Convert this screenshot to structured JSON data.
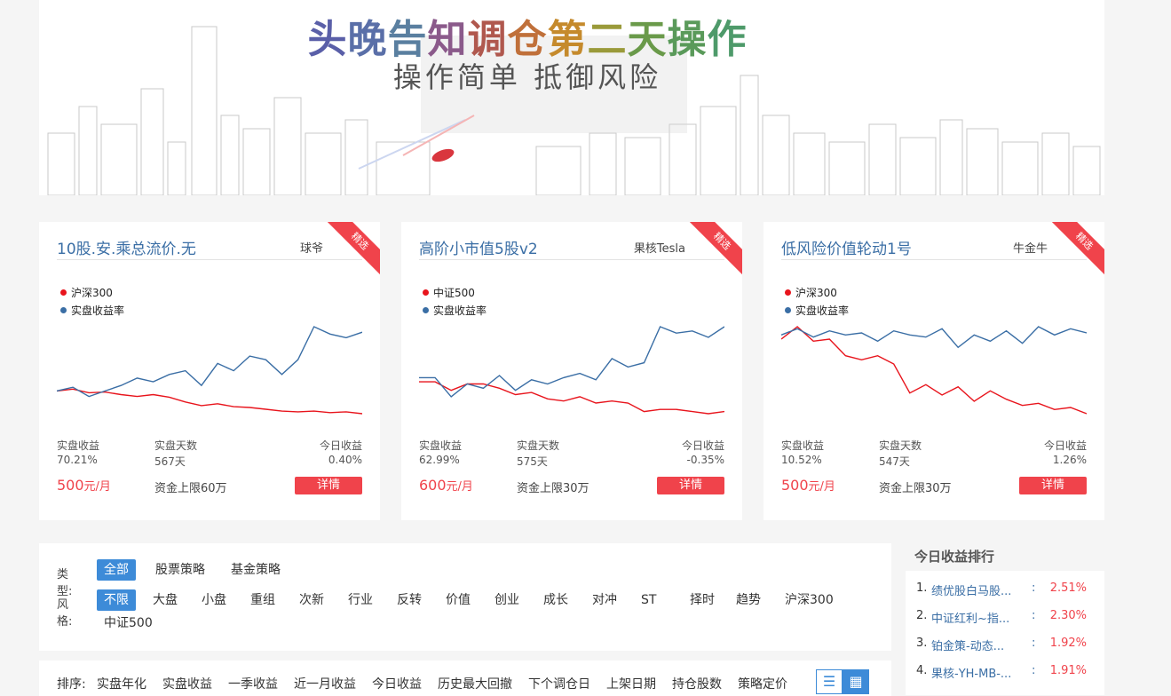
{
  "banner": {
    "title_chars": [
      "头",
      "晚",
      "告",
      "知",
      "调",
      "仓",
      "第",
      "二",
      "天",
      "操",
      "作"
    ],
    "title_colors": [
      "#5a5fa8",
      "#5a6fa8",
      "#5a7fa0",
      "#8b5a8b",
      "#b0584e",
      "#c0703a",
      "#c58a2c",
      "#9a9a3a",
      "#6a9a4a",
      "#5a9a5a",
      "#4e9a6a"
    ],
    "subtitle": "操作简单  抵御风险"
  },
  "cards": [
    {
      "name": "10股.安.乘总流价.无",
      "author": "球爷",
      "ribbon": "精选",
      "legend": [
        "沪深300",
        "实盘收益率"
      ],
      "stats": [
        {
          "label": "实盘收益",
          "value": "70.21%"
        },
        {
          "label": "实盘天数",
          "value": "567天"
        },
        {
          "label": "今日收益",
          "value": "0.40%"
        }
      ],
      "price": "500",
      "price_unit": "元/月",
      "capacity": "资金上限60万",
      "detail": "详情",
      "series_red": [
        0.45,
        0.5,
        0.4,
        0.42,
        0.35,
        0.3,
        0.35,
        0.28,
        0.15,
        0.05,
        0.1,
        0.02,
        0.0,
        -0.05,
        -0.1,
        -0.12,
        -0.1,
        -0.14,
        -0.12,
        -0.17
      ],
      "series_blue": [
        0.45,
        0.55,
        0.3,
        0.45,
        0.6,
        0.8,
        0.7,
        0.9,
        1.0,
        0.6,
        1.2,
        1.0,
        1.4,
        1.3,
        0.9,
        1.3,
        2.2,
        2.0,
        1.9,
        2.05
      ]
    },
    {
      "name": "高阶小市值5股v2",
      "author": "果核Tesla",
      "ribbon": "精选",
      "legend": [
        "中证500",
        "实盘收益率"
      ],
      "stats": [
        {
          "label": "实盘收益",
          "value": "62.99%"
        },
        {
          "label": "实盘天数",
          "value": "575天"
        },
        {
          "label": "今日收益",
          "value": "-0.35%"
        }
      ],
      "price": "600",
      "price_unit": "元/月",
      "capacity": "资金上限30万",
      "detail": "详情",
      "series_red": [
        0.75,
        0.75,
        0.55,
        0.7,
        0.7,
        0.6,
        0.45,
        0.5,
        0.35,
        0.3,
        0.4,
        0.25,
        0.3,
        0.25,
        0.05,
        0.1,
        0.1,
        0.05,
        0.0,
        0.05
      ],
      "series_blue": [
        0.85,
        0.85,
        0.4,
        0.7,
        0.6,
        0.9,
        0.55,
        0.8,
        0.7,
        0.85,
        0.95,
        0.8,
        1.3,
        1.1,
        1.2,
        2.05,
        1.9,
        1.95,
        1.8,
        2.05
      ]
    },
    {
      "name": "低风险价值轮动1号",
      "author": "牛金牛",
      "ribbon": "精选",
      "legend": [
        "沪深300",
        "实盘收益率"
      ],
      "stats": [
        {
          "label": "实盘收益",
          "value": "10.52%"
        },
        {
          "label": "实盘天数",
          "value": "547天"
        },
        {
          "label": "今日收益",
          "value": "1.26%"
        }
      ],
      "price": "500",
      "price_unit": "元/月",
      "capacity": "资金上限30万",
      "detail": "详情",
      "series_red": [
        0.9,
        1.2,
        0.85,
        0.9,
        0.5,
        0.4,
        0.5,
        0.3,
        -0.4,
        -0.2,
        -0.45,
        -0.25,
        -0.6,
        -0.35,
        -0.55,
        -0.7,
        -0.65,
        -0.8,
        -0.75,
        -0.9
      ],
      "series_blue": [
        1.0,
        1.15,
        0.95,
        1.1,
        1.0,
        1.05,
        0.85,
        1.1,
        1.0,
        0.95,
        1.15,
        0.7,
        1.0,
        0.85,
        1.1,
        0.8,
        1.2,
        1.0,
        1.15,
        1.05
      ]
    }
  ],
  "filter": {
    "type_label": "类型:",
    "types": [
      "全部",
      "股票策略",
      "基金策略"
    ],
    "style_label": "风格:",
    "styles": [
      "不限",
      "大盘",
      "小盘",
      "重组",
      "次新",
      "行业",
      "反转",
      "价值",
      "创业",
      "成长",
      "对冲",
      "ST",
      "择时",
      "趋势",
      "沪深300"
    ],
    "styles_row2": [
      "中证500"
    ]
  },
  "sort": {
    "label": "排序:",
    "items": [
      "实盘年化",
      "实盘收益",
      "一季收益",
      "近一月收益",
      "今日收益",
      "历史最大回撤",
      "下个调仓日",
      "上架日期",
      "持仓股数",
      "策略定价"
    ],
    "list_icon": "☰",
    "grid_icon": "▦"
  },
  "rank": {
    "title": "今日收益排行",
    "items": [
      {
        "idx": "1.",
        "name": "绩优股白马股...",
        "colon": ":",
        "value": "2.51%"
      },
      {
        "idx": "2.",
        "name": "中证红利~指...",
        "colon": ":",
        "value": "2.30%"
      },
      {
        "idx": "3.",
        "name": "铂金策-动态...",
        "colon": ":",
        "value": "1.92%"
      },
      {
        "idx": "4.",
        "name": "果核-YH-MB-...",
        "colon": ":",
        "value": "1.91%"
      }
    ]
  },
  "colors": {
    "red": "#e8141c",
    "blue": "#3a6ea5",
    "accent": "#3d8bd8",
    "badge": "#f0434b"
  }
}
